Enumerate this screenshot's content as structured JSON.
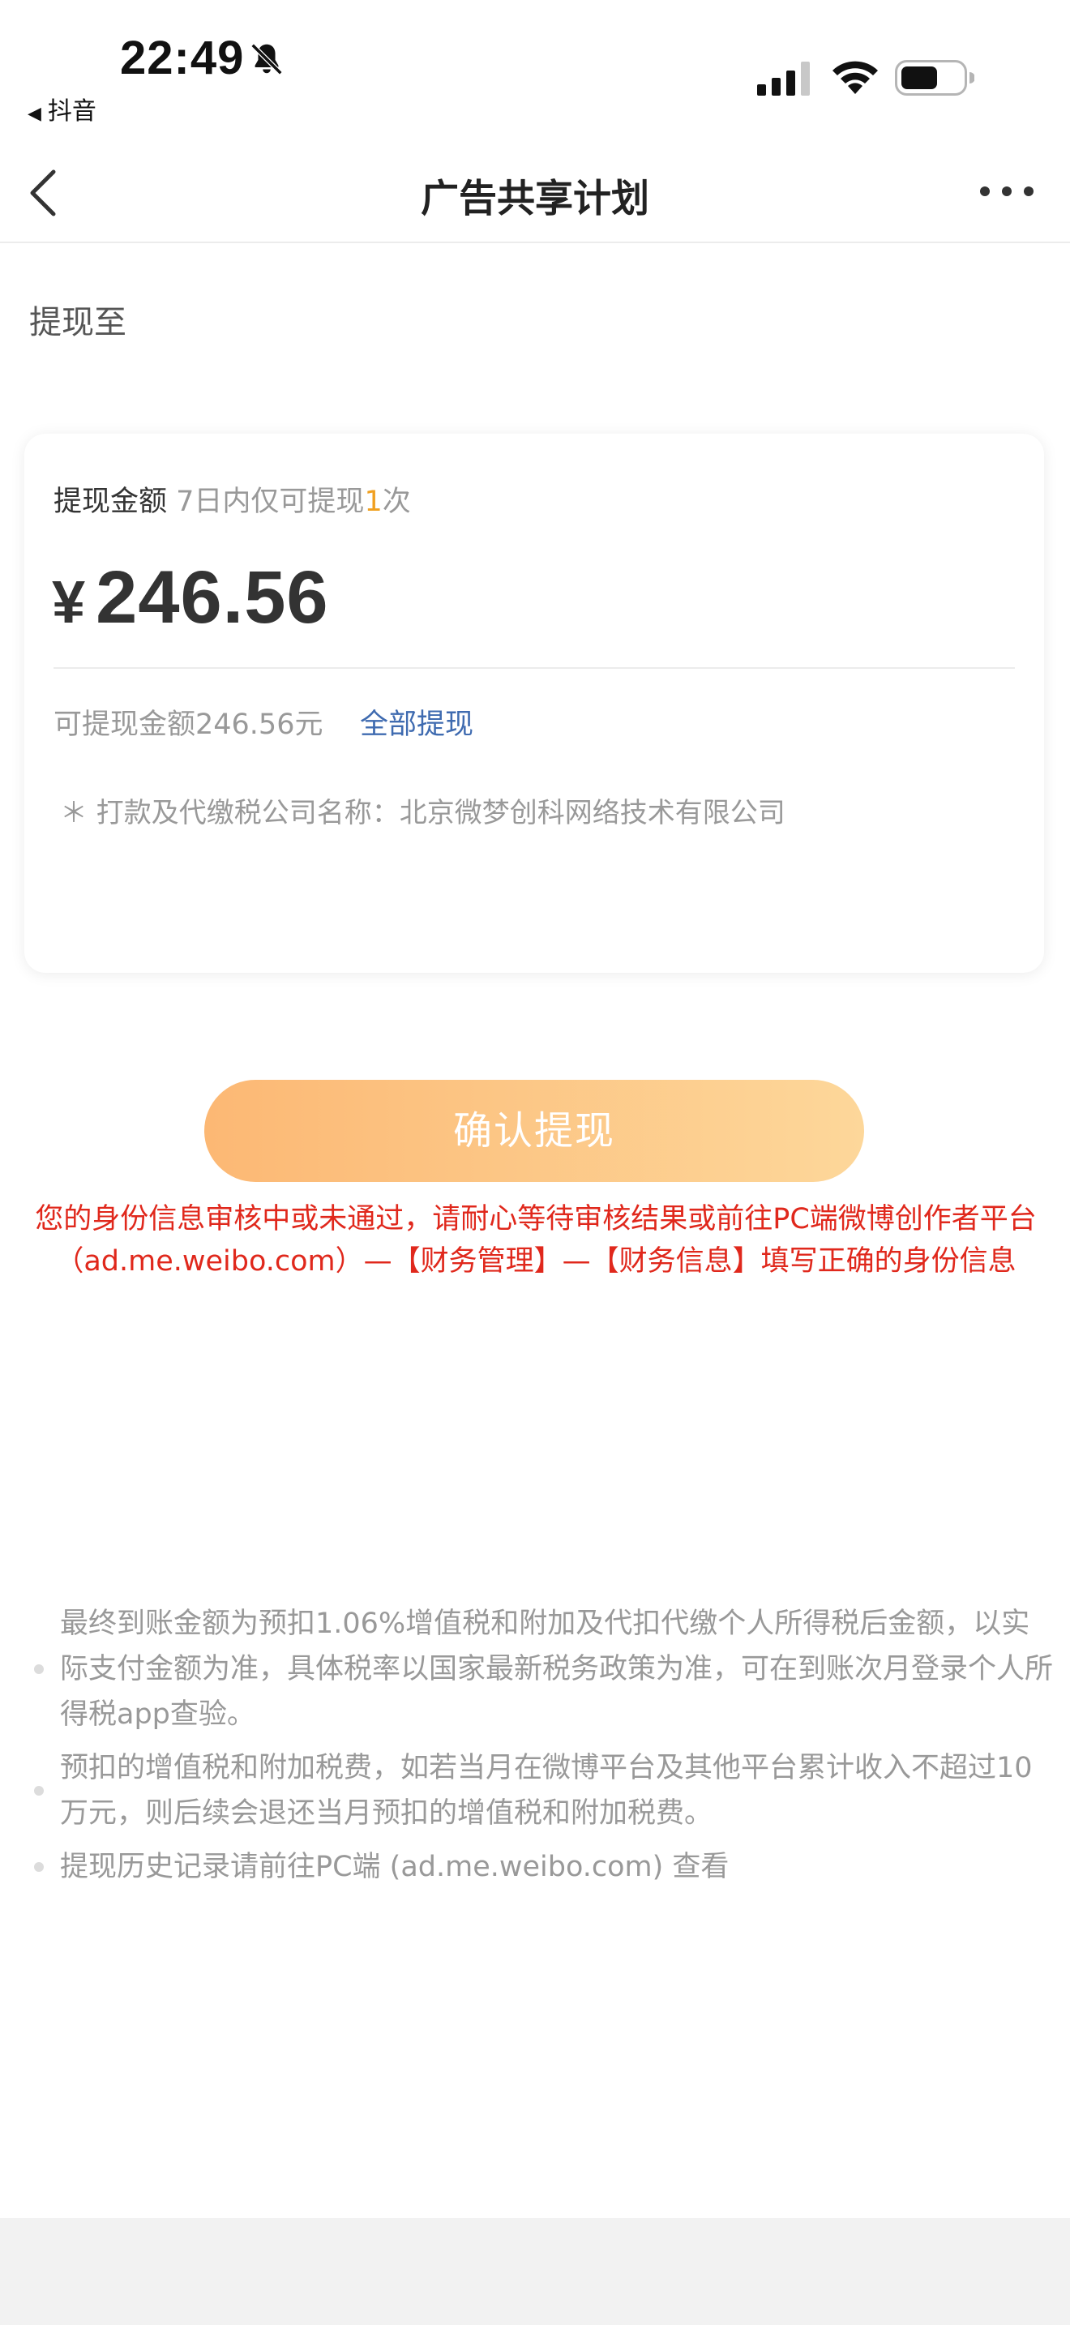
{
  "status_bar": {
    "time": "22:49",
    "back_app_label": "抖音",
    "icons": [
      "bell-off-icon",
      "cellular-signal-icon",
      "wifi-icon",
      "battery-icon"
    ]
  },
  "nav": {
    "title": "广告共享计划",
    "back_icon": "chevron-left-icon",
    "more_icon": "more-dots-icon"
  },
  "withdraw_to": {
    "label": "提现至"
  },
  "card": {
    "amount_label": "提现金额",
    "limit_prefix": "7日内仅可提现",
    "limit_count": "1",
    "limit_suffix": "次",
    "currency_symbol": "¥",
    "amount": "246.56",
    "available_text": "可提现金额246.56元",
    "withdraw_all_label": "全部提现",
    "company_note": "＊ 打款及代缴税公司名称：北京微梦创科网络技术有限公司"
  },
  "confirm_button": {
    "label": "确认提现"
  },
  "error_message": "您的身份信息审核中或未通过，请耐心等待审核结果或前往PC端微博创作者平台（ad.me.weibo.com）—【财务管理】—【财务信息】填写正确的身份信息",
  "notes": [
    "最终到账金额为预扣1.06%增值税和附加及代扣代缴个人所得税后金额，以实际支付金额为准，具体税率以国家最新税务政策为准，可在到账次月登录个人所得税app查验。",
    "预扣的增值税和附加税费，如若当月在微博平台及其他平台累计收入不超过10万元，则后续会退还当月预扣的增值税和附加税费。",
    "提现历史记录请前往PC端 (ad.me.weibo.com) 查看"
  ],
  "colors": {
    "accent_orange": "#f0a020",
    "link_blue": "#3f6bb0",
    "error_red": "#e0281c",
    "button_gradient_start": "#fcb874",
    "button_gradient_end": "#fdd79a"
  }
}
